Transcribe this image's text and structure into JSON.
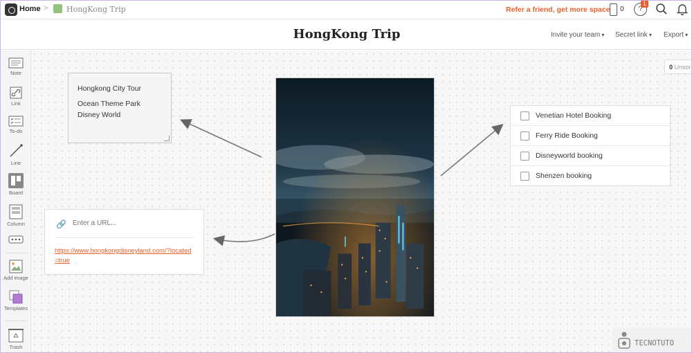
{
  "topbar": {
    "home_label": "Home",
    "breadcrumb_sep": ">",
    "board_name": "HongKong Trip",
    "refer_text": "Refer a friend, get more space",
    "phone_count": "0",
    "help_glyph": "?",
    "notification_badge": "1",
    "icons": [
      "logo-icon",
      "phone-icon",
      "help-icon",
      "search-icon",
      "bell-icon"
    ]
  },
  "titlebar": {
    "title": "HongKong Trip",
    "invite_label": "Invite your team",
    "secret_link_label": "Secret link",
    "export_label": "Export"
  },
  "sidebar": {
    "tools": [
      {
        "label": "Note",
        "icon": "note-icon"
      },
      {
        "label": "Link",
        "icon": "link-icon"
      },
      {
        "label": "To-do",
        "icon": "todo-icon"
      },
      {
        "label": "Line",
        "icon": "line-icon"
      },
      {
        "label": "Board",
        "icon": "board-icon"
      },
      {
        "label": "Column",
        "icon": "column-icon"
      },
      {
        "label": "",
        "icon": "more-icon"
      },
      {
        "label": "Add image",
        "icon": "image-icon"
      },
      {
        "label": "Templates",
        "icon": "templates-icon"
      },
      {
        "label": "Trash",
        "icon": "trash-icon"
      }
    ]
  },
  "note": {
    "line1": "Hongkong City Tour",
    "line2": "Ocean Theme Park Disney World"
  },
  "link_card": {
    "placeholder": "Enter a URL...",
    "url": "https://www.hongkongdisneyland.com/?located=true"
  },
  "todo": {
    "items": [
      {
        "label": "Venetian Hotel Booking",
        "checked": false
      },
      {
        "label": "Ferry Ride Booking",
        "checked": false
      },
      {
        "label": "Disneyworld booking",
        "checked": false
      },
      {
        "label": "Shenzen booking",
        "checked": false
      }
    ]
  },
  "unsorted": {
    "count": "0",
    "label": "Unsor"
  },
  "watermark": {
    "text": "TECNOTUTO"
  },
  "colors": {
    "accent": "#e8612c",
    "board_swatch": "#93c47d"
  }
}
